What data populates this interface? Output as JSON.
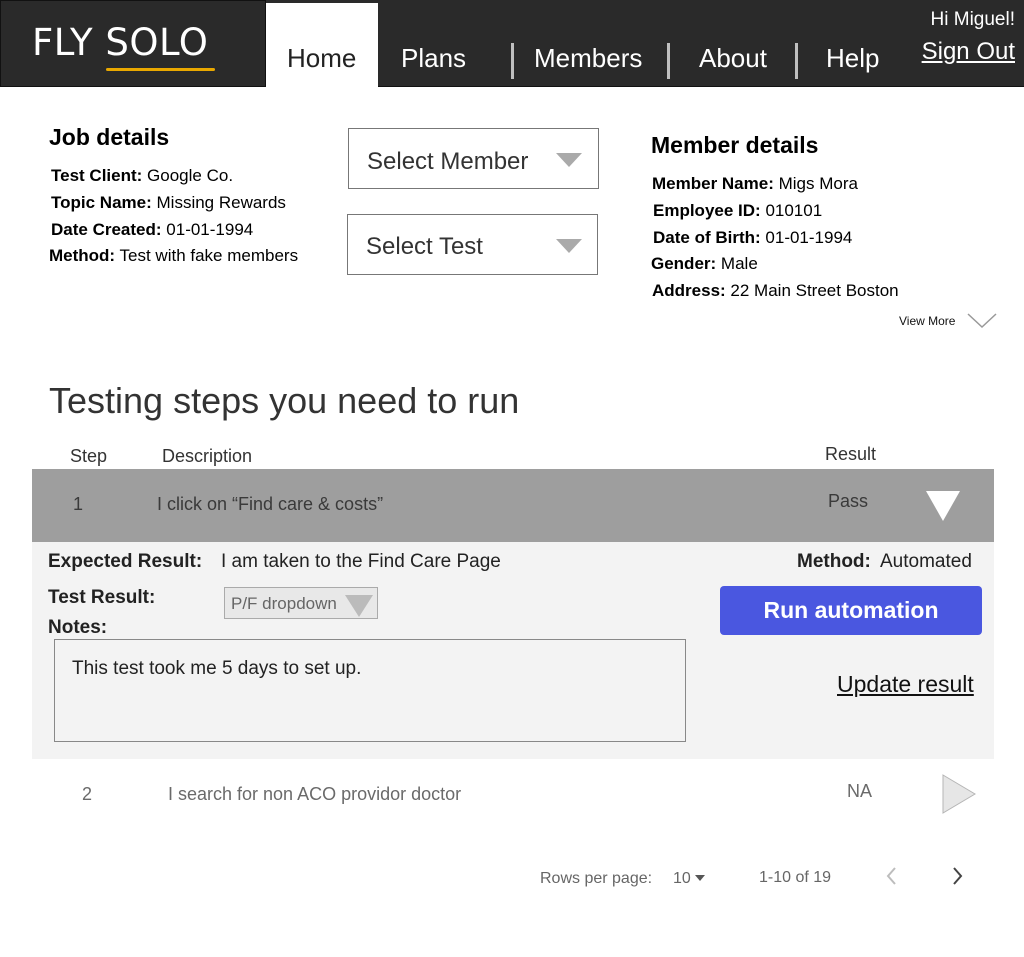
{
  "header": {
    "logo": "FLY SOLO",
    "nav": [
      "Home",
      "Plans",
      "Members",
      "About",
      "Help"
    ],
    "greeting": "Hi Miguel!",
    "sign_out": "Sign Out"
  },
  "job_details": {
    "title": "Job details",
    "fields": [
      {
        "label": "Test Client:",
        "value": "Google Co."
      },
      {
        "label": "Topic Name:",
        "value": "Missing Rewards"
      },
      {
        "label": "Date Created:",
        "value": "01-01-1994"
      },
      {
        "label": "Method:",
        "value": "Test with fake members"
      }
    ]
  },
  "selects": {
    "member": "Select Member",
    "test": "Select Test"
  },
  "member_details": {
    "title": "Member details",
    "fields": [
      {
        "label": "Member Name:",
        "value": "Migs Mora"
      },
      {
        "label": "Employee ID:",
        "value": "010101"
      },
      {
        "label": "Date of Birth:",
        "value": "01-01-1994"
      },
      {
        "label": "Gender:",
        "value": "Male"
      },
      {
        "label": "Address:",
        "value": "22 Main Street Boston"
      }
    ],
    "view_more": "View More"
  },
  "steps": {
    "title": "Testing steps you need to run",
    "columns": {
      "step": "Step",
      "description": "Description",
      "result": "Result"
    },
    "rows": [
      {
        "step": "1",
        "description": "I click on “Find care & costs”",
        "result": "Pass"
      },
      {
        "step": "2",
        "description": "I search for non ACO providor doctor",
        "result": "NA"
      }
    ],
    "detail": {
      "expected_label": "Expected Result:",
      "expected_value": "I am taken to the Find Care Page",
      "method_label": "Method:",
      "method_value": "Automated",
      "test_result_label": "Test Result:",
      "test_result_dropdown": "P/F dropdown",
      "notes_label": "Notes:",
      "notes_value": "This test took me 5 days to set up.",
      "run_button": "Run automation",
      "update_link": "Update result"
    }
  },
  "pagination": {
    "rows_per_page_label": "Rows per page:",
    "rows_per_page_value": "10",
    "range": "1-10 of 19"
  }
}
